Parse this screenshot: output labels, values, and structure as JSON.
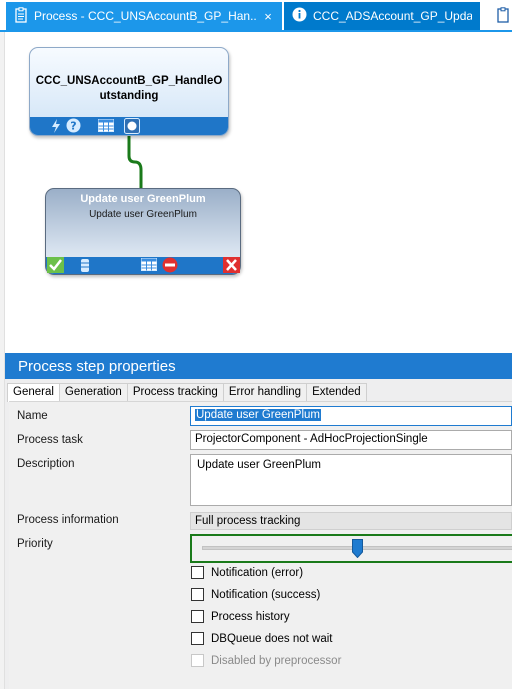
{
  "tabs": [
    {
      "title": "Process - CCC_UNSAccountB_GP_Han... *",
      "close": "×"
    },
    {
      "title": "CCC_ADSAccount_GP_Update"
    }
  ],
  "canvas": {
    "node1": {
      "title": "CCC_UNSAccountB_GP_HandleOutstanding"
    },
    "node2": {
      "title": "Update user GreenPlum",
      "subtitle": "Update user GreenPlum"
    }
  },
  "properties": {
    "header": "Process step properties",
    "tabs": [
      "General",
      "Generation",
      "Process tracking",
      "Error handling",
      "Extended"
    ],
    "active_tab": "General",
    "fields": {
      "name_label": "Name",
      "name_value": "Update user GreenPlum",
      "process_task_label": "Process task",
      "process_task_value": "ProjectorComponent - AdHocProjectionSingle",
      "description_label": "Description",
      "description_value": "Update user GreenPlum",
      "process_information_label": "Process information",
      "process_information_value": "Full process tracking",
      "priority_label": "Priority"
    },
    "checkboxes": [
      {
        "label": "Notification (error)",
        "checked": false,
        "enabled": true
      },
      {
        "label": "Notification (success)",
        "checked": false,
        "enabled": true
      },
      {
        "label": "Process history",
        "checked": false,
        "enabled": true
      },
      {
        "label": "DBQueue does not wait",
        "checked": false,
        "enabled": true
      },
      {
        "label": "Disabled by preprocessor",
        "checked": false,
        "enabled": false
      }
    ]
  },
  "colors": {
    "accent": "#1c97ea",
    "tab_inactive": "#007acc",
    "header": "#1f7bd0",
    "connector": "#1a7a1a"
  }
}
